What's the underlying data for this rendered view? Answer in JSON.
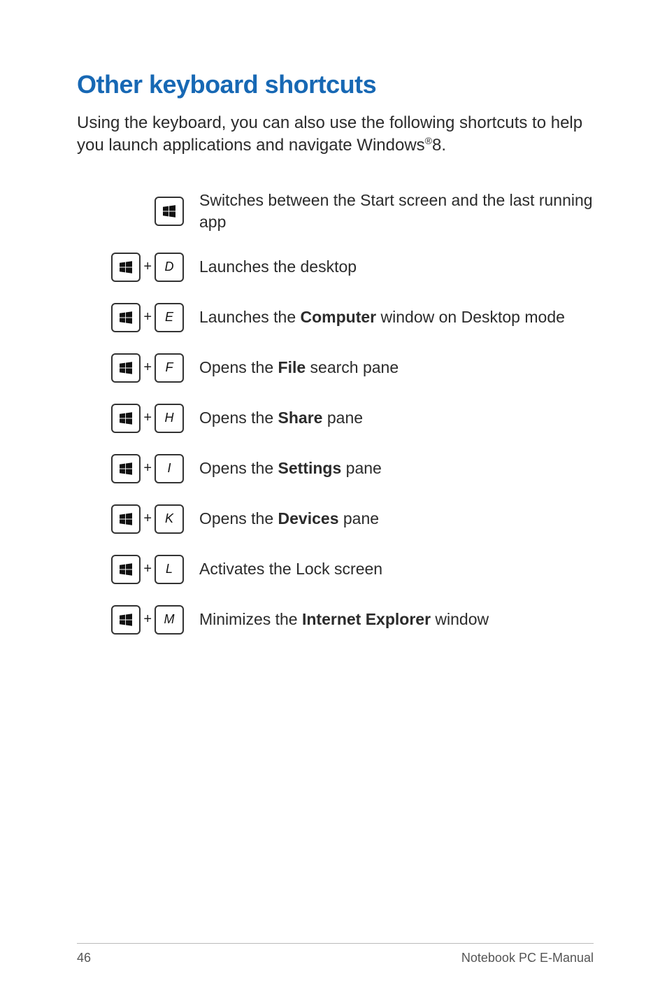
{
  "heading": "Other keyboard shortcuts",
  "intro": {
    "pre": "Using the keyboard, you can also use the following shortcuts to help you launch applications and navigate Windows",
    "sup": "®",
    "post": "8."
  },
  "plus_symbol": "+",
  "shortcuts": [
    {
      "combo": [
        "win"
      ],
      "desc_pre": "Switches between the Start screen and the last running app",
      "bold": "",
      "desc_post": ""
    },
    {
      "combo": [
        "win",
        "D"
      ],
      "desc_pre": "Launches the desktop",
      "bold": "",
      "desc_post": ""
    },
    {
      "combo": [
        "win",
        "E"
      ],
      "desc_pre": "Launches the ",
      "bold": "Computer",
      "desc_post": " window on Desktop mode"
    },
    {
      "combo": [
        "win",
        "F"
      ],
      "desc_pre": "Opens the ",
      "bold": "File",
      "desc_post": " search pane"
    },
    {
      "combo": [
        "win",
        "H"
      ],
      "desc_pre": "Opens the ",
      "bold": "Share",
      "desc_post": " pane"
    },
    {
      "combo": [
        "win",
        "I"
      ],
      "desc_pre": "Opens the ",
      "bold": "Settings",
      "desc_post": " pane"
    },
    {
      "combo": [
        "win",
        "K"
      ],
      "desc_pre": "Opens the ",
      "bold": "Devices",
      "desc_post": " pane"
    },
    {
      "combo": [
        "win",
        "L"
      ],
      "desc_pre": "Activates the Lock screen",
      "bold": "",
      "desc_post": ""
    },
    {
      "combo": [
        "win",
        "M"
      ],
      "desc_pre": "Minimizes the ",
      "bold": "Internet Explorer",
      "desc_post": " window"
    }
  ],
  "footer": {
    "page_number": "46",
    "doc_title": "Notebook PC E-Manual"
  }
}
